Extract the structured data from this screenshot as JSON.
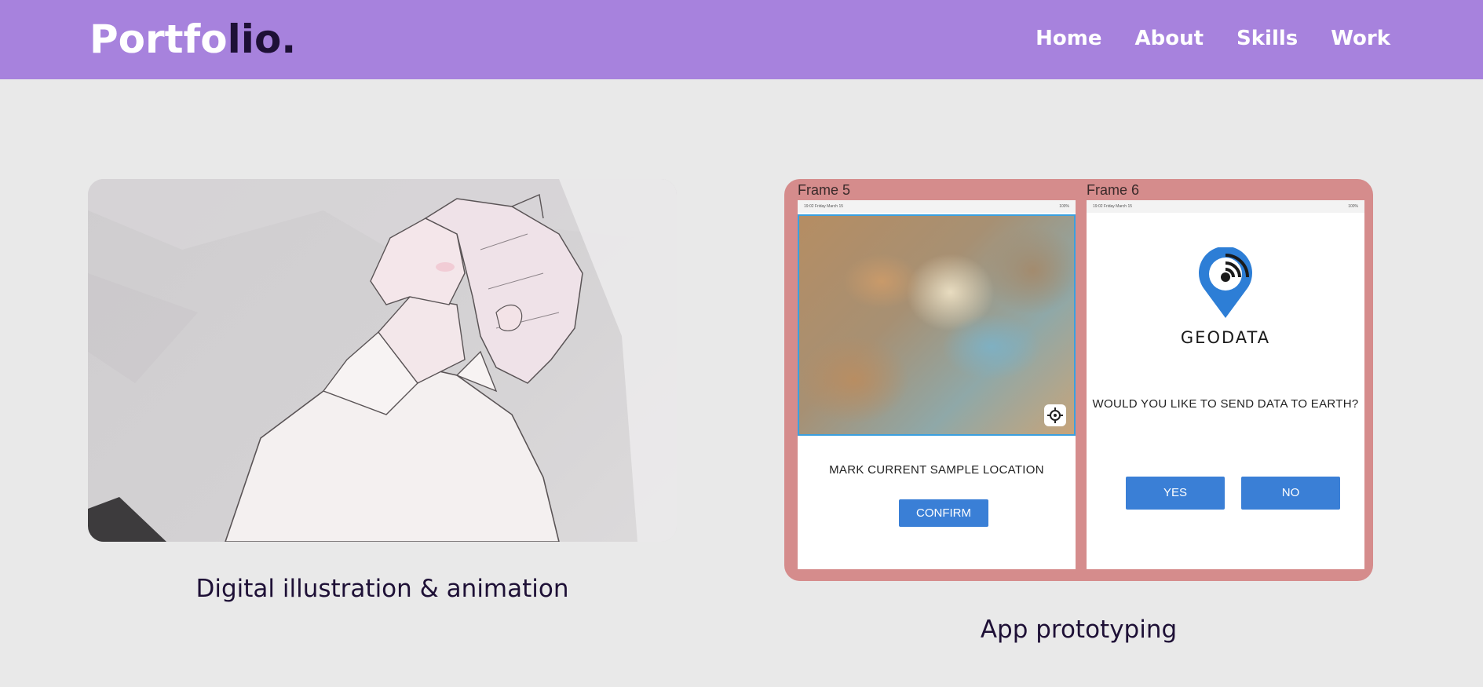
{
  "header": {
    "logo_part1": "Portfo",
    "logo_part2": "lio.",
    "nav": [
      "Home",
      "About",
      "Skills",
      "Work"
    ]
  },
  "projects": [
    {
      "caption": "Digital illustration & animation"
    },
    {
      "caption": "App prototyping",
      "frames": [
        {
          "label": "Frame 5",
          "statusbar_left": "19:02 Friday March 15",
          "statusbar_right": "100%",
          "prompt": "MARK CURRENT SAMPLE LOCATION",
          "button": "CONFIRM"
        },
        {
          "label": "Frame 6",
          "statusbar_left": "19:02 Friday March 15",
          "statusbar_right": "100%",
          "brand": "GEODATA",
          "prompt": "WOULD YOU LIKE TO SEND DATA TO EARTH?",
          "yes_button": "YES",
          "no_button": "NO"
        }
      ]
    }
  ],
  "colors": {
    "header_bg": "#a782dd",
    "page_bg": "#e9e9e9",
    "logo_dark": "#1e1036",
    "proto_bg": "#d58c8c",
    "button_blue": "#3a7fd6"
  }
}
